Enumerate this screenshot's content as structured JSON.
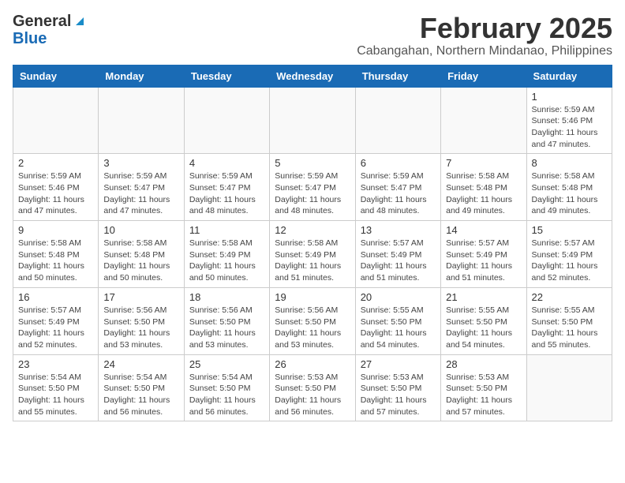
{
  "header": {
    "logo_general": "General",
    "logo_blue": "Blue",
    "month_year": "February 2025",
    "location": "Cabangahan, Northern Mindanao, Philippines"
  },
  "weekdays": [
    "Sunday",
    "Monday",
    "Tuesday",
    "Wednesday",
    "Thursday",
    "Friday",
    "Saturday"
  ],
  "weeks": [
    [
      {
        "day": "",
        "info": ""
      },
      {
        "day": "",
        "info": ""
      },
      {
        "day": "",
        "info": ""
      },
      {
        "day": "",
        "info": ""
      },
      {
        "day": "",
        "info": ""
      },
      {
        "day": "",
        "info": ""
      },
      {
        "day": "1",
        "info": "Sunrise: 5:59 AM\nSunset: 5:46 PM\nDaylight: 11 hours\nand 47 minutes."
      }
    ],
    [
      {
        "day": "2",
        "info": "Sunrise: 5:59 AM\nSunset: 5:46 PM\nDaylight: 11 hours\nand 47 minutes."
      },
      {
        "day": "3",
        "info": "Sunrise: 5:59 AM\nSunset: 5:47 PM\nDaylight: 11 hours\nand 47 minutes."
      },
      {
        "day": "4",
        "info": "Sunrise: 5:59 AM\nSunset: 5:47 PM\nDaylight: 11 hours\nand 48 minutes."
      },
      {
        "day": "5",
        "info": "Sunrise: 5:59 AM\nSunset: 5:47 PM\nDaylight: 11 hours\nand 48 minutes."
      },
      {
        "day": "6",
        "info": "Sunrise: 5:59 AM\nSunset: 5:47 PM\nDaylight: 11 hours\nand 48 minutes."
      },
      {
        "day": "7",
        "info": "Sunrise: 5:58 AM\nSunset: 5:48 PM\nDaylight: 11 hours\nand 49 minutes."
      },
      {
        "day": "8",
        "info": "Sunrise: 5:58 AM\nSunset: 5:48 PM\nDaylight: 11 hours\nand 49 minutes."
      }
    ],
    [
      {
        "day": "9",
        "info": "Sunrise: 5:58 AM\nSunset: 5:48 PM\nDaylight: 11 hours\nand 50 minutes."
      },
      {
        "day": "10",
        "info": "Sunrise: 5:58 AM\nSunset: 5:48 PM\nDaylight: 11 hours\nand 50 minutes."
      },
      {
        "day": "11",
        "info": "Sunrise: 5:58 AM\nSunset: 5:49 PM\nDaylight: 11 hours\nand 50 minutes."
      },
      {
        "day": "12",
        "info": "Sunrise: 5:58 AM\nSunset: 5:49 PM\nDaylight: 11 hours\nand 51 minutes."
      },
      {
        "day": "13",
        "info": "Sunrise: 5:57 AM\nSunset: 5:49 PM\nDaylight: 11 hours\nand 51 minutes."
      },
      {
        "day": "14",
        "info": "Sunrise: 5:57 AM\nSunset: 5:49 PM\nDaylight: 11 hours\nand 51 minutes."
      },
      {
        "day": "15",
        "info": "Sunrise: 5:57 AM\nSunset: 5:49 PM\nDaylight: 11 hours\nand 52 minutes."
      }
    ],
    [
      {
        "day": "16",
        "info": "Sunrise: 5:57 AM\nSunset: 5:49 PM\nDaylight: 11 hours\nand 52 minutes."
      },
      {
        "day": "17",
        "info": "Sunrise: 5:56 AM\nSunset: 5:50 PM\nDaylight: 11 hours\nand 53 minutes."
      },
      {
        "day": "18",
        "info": "Sunrise: 5:56 AM\nSunset: 5:50 PM\nDaylight: 11 hours\nand 53 minutes."
      },
      {
        "day": "19",
        "info": "Sunrise: 5:56 AM\nSunset: 5:50 PM\nDaylight: 11 hours\nand 53 minutes."
      },
      {
        "day": "20",
        "info": "Sunrise: 5:55 AM\nSunset: 5:50 PM\nDaylight: 11 hours\nand 54 minutes."
      },
      {
        "day": "21",
        "info": "Sunrise: 5:55 AM\nSunset: 5:50 PM\nDaylight: 11 hours\nand 54 minutes."
      },
      {
        "day": "22",
        "info": "Sunrise: 5:55 AM\nSunset: 5:50 PM\nDaylight: 11 hours\nand 55 minutes."
      }
    ],
    [
      {
        "day": "23",
        "info": "Sunrise: 5:54 AM\nSunset: 5:50 PM\nDaylight: 11 hours\nand 55 minutes."
      },
      {
        "day": "24",
        "info": "Sunrise: 5:54 AM\nSunset: 5:50 PM\nDaylight: 11 hours\nand 56 minutes."
      },
      {
        "day": "25",
        "info": "Sunrise: 5:54 AM\nSunset: 5:50 PM\nDaylight: 11 hours\nand 56 minutes."
      },
      {
        "day": "26",
        "info": "Sunrise: 5:53 AM\nSunset: 5:50 PM\nDaylight: 11 hours\nand 56 minutes."
      },
      {
        "day": "27",
        "info": "Sunrise: 5:53 AM\nSunset: 5:50 PM\nDaylight: 11 hours\nand 57 minutes."
      },
      {
        "day": "28",
        "info": "Sunrise: 5:53 AM\nSunset: 5:50 PM\nDaylight: 11 hours\nand 57 minutes."
      },
      {
        "day": "",
        "info": ""
      }
    ]
  ]
}
